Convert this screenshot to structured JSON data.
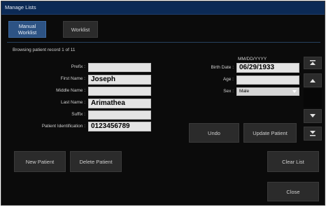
{
  "window": {
    "title": "Manage Lists"
  },
  "tabs": [
    {
      "label": "Manual Worklist",
      "active": true
    },
    {
      "label": "Worklist",
      "active": false
    }
  ],
  "status": {
    "record_text": "Browsing patient record 1 of 11"
  },
  "labels": {
    "prefix": "Prefix :",
    "first_name": "First Name :",
    "middle_name": "Middle Name :",
    "last_name": "Last Name :",
    "suffix": "Suffix :",
    "patient_id": "Patient Identification :",
    "birth_date": "Birth Date :",
    "age": "Age :",
    "sex": "Sex :",
    "date_format_hint": "MM/DD/YYYY"
  },
  "fields": {
    "prefix": "",
    "first_name": "Joseph",
    "middle_name": "",
    "last_name": "Arimathea",
    "suffix": "",
    "patient_id": "0123456789",
    "birth_date": "06/29/1933",
    "age": "",
    "sex": "Male"
  },
  "buttons": {
    "undo": "Undo",
    "update_patient": "Update Patient",
    "new_patient": "New Patient",
    "delete_patient": "Delete Patient",
    "clear_list": "Clear List",
    "close": "Close"
  },
  "nav_icons": [
    "first-record-icon",
    "previous-record-icon",
    "next-record-icon",
    "last-record-icon"
  ]
}
